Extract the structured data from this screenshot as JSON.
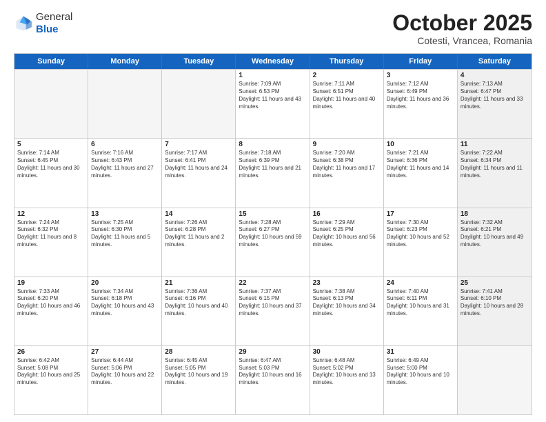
{
  "header": {
    "logo": {
      "general": "General",
      "blue": "Blue"
    },
    "title": "October 2025",
    "subtitle": "Cotesti, Vrancea, Romania"
  },
  "weekdays": [
    "Sunday",
    "Monday",
    "Tuesday",
    "Wednesday",
    "Thursday",
    "Friday",
    "Saturday"
  ],
  "rows": [
    [
      {
        "day": "",
        "empty": true
      },
      {
        "day": "",
        "empty": true
      },
      {
        "day": "",
        "empty": true
      },
      {
        "day": "1",
        "sunrise": "7:09 AM",
        "sunset": "6:53 PM",
        "daylight": "11 hours and 43 minutes."
      },
      {
        "day": "2",
        "sunrise": "7:11 AM",
        "sunset": "6:51 PM",
        "daylight": "11 hours and 40 minutes."
      },
      {
        "day": "3",
        "sunrise": "7:12 AM",
        "sunset": "6:49 PM",
        "daylight": "11 hours and 36 minutes."
      },
      {
        "day": "4",
        "sunrise": "7:13 AM",
        "sunset": "6:47 PM",
        "daylight": "11 hours and 33 minutes.",
        "shaded": true
      }
    ],
    [
      {
        "day": "5",
        "sunrise": "7:14 AM",
        "sunset": "6:45 PM",
        "daylight": "11 hours and 30 minutes."
      },
      {
        "day": "6",
        "sunrise": "7:16 AM",
        "sunset": "6:43 PM",
        "daylight": "11 hours and 27 minutes."
      },
      {
        "day": "7",
        "sunrise": "7:17 AM",
        "sunset": "6:41 PM",
        "daylight": "11 hours and 24 minutes."
      },
      {
        "day": "8",
        "sunrise": "7:18 AM",
        "sunset": "6:39 PM",
        "daylight": "11 hours and 21 minutes."
      },
      {
        "day": "9",
        "sunrise": "7:20 AM",
        "sunset": "6:38 PM",
        "daylight": "11 hours and 17 minutes."
      },
      {
        "day": "10",
        "sunrise": "7:21 AM",
        "sunset": "6:36 PM",
        "daylight": "11 hours and 14 minutes."
      },
      {
        "day": "11",
        "sunrise": "7:22 AM",
        "sunset": "6:34 PM",
        "daylight": "11 hours and 11 minutes.",
        "shaded": true
      }
    ],
    [
      {
        "day": "12",
        "sunrise": "7:24 AM",
        "sunset": "6:32 PM",
        "daylight": "11 hours and 8 minutes."
      },
      {
        "day": "13",
        "sunrise": "7:25 AM",
        "sunset": "6:30 PM",
        "daylight": "11 hours and 5 minutes."
      },
      {
        "day": "14",
        "sunrise": "7:26 AM",
        "sunset": "6:28 PM",
        "daylight": "11 hours and 2 minutes."
      },
      {
        "day": "15",
        "sunrise": "7:28 AM",
        "sunset": "6:27 PM",
        "daylight": "10 hours and 59 minutes."
      },
      {
        "day": "16",
        "sunrise": "7:29 AM",
        "sunset": "6:25 PM",
        "daylight": "10 hours and 56 minutes."
      },
      {
        "day": "17",
        "sunrise": "7:30 AM",
        "sunset": "6:23 PM",
        "daylight": "10 hours and 52 minutes."
      },
      {
        "day": "18",
        "sunrise": "7:32 AM",
        "sunset": "6:21 PM",
        "daylight": "10 hours and 49 minutes.",
        "shaded": true
      }
    ],
    [
      {
        "day": "19",
        "sunrise": "7:33 AM",
        "sunset": "6:20 PM",
        "daylight": "10 hours and 46 minutes."
      },
      {
        "day": "20",
        "sunrise": "7:34 AM",
        "sunset": "6:18 PM",
        "daylight": "10 hours and 43 minutes."
      },
      {
        "day": "21",
        "sunrise": "7:36 AM",
        "sunset": "6:16 PM",
        "daylight": "10 hours and 40 minutes."
      },
      {
        "day": "22",
        "sunrise": "7:37 AM",
        "sunset": "6:15 PM",
        "daylight": "10 hours and 37 minutes."
      },
      {
        "day": "23",
        "sunrise": "7:38 AM",
        "sunset": "6:13 PM",
        "daylight": "10 hours and 34 minutes."
      },
      {
        "day": "24",
        "sunrise": "7:40 AM",
        "sunset": "6:11 PM",
        "daylight": "10 hours and 31 minutes."
      },
      {
        "day": "25",
        "sunrise": "7:41 AM",
        "sunset": "6:10 PM",
        "daylight": "10 hours and 28 minutes.",
        "shaded": true
      }
    ],
    [
      {
        "day": "26",
        "sunrise": "6:42 AM",
        "sunset": "5:08 PM",
        "daylight": "10 hours and 25 minutes."
      },
      {
        "day": "27",
        "sunrise": "6:44 AM",
        "sunset": "5:06 PM",
        "daylight": "10 hours and 22 minutes."
      },
      {
        "day": "28",
        "sunrise": "6:45 AM",
        "sunset": "5:05 PM",
        "daylight": "10 hours and 19 minutes."
      },
      {
        "day": "29",
        "sunrise": "6:47 AM",
        "sunset": "5:03 PM",
        "daylight": "10 hours and 16 minutes."
      },
      {
        "day": "30",
        "sunrise": "6:48 AM",
        "sunset": "5:02 PM",
        "daylight": "10 hours and 13 minutes."
      },
      {
        "day": "31",
        "sunrise": "6:49 AM",
        "sunset": "5:00 PM",
        "daylight": "10 hours and 10 minutes."
      },
      {
        "day": "",
        "empty": true,
        "shaded": true
      }
    ]
  ]
}
